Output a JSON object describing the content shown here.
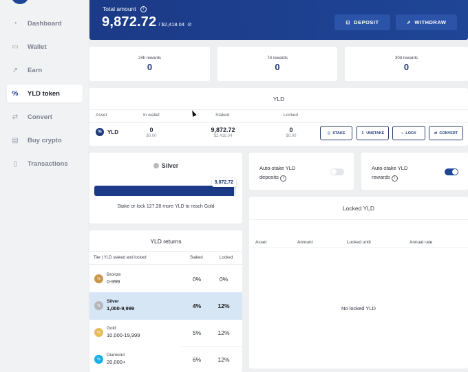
{
  "sidebar": {
    "items": [
      {
        "label": "Dashboard",
        "icon": "dashboard-icon",
        "glyph": "◔",
        "active": false
      },
      {
        "label": "Wallet",
        "icon": "wallet-icon",
        "glyph": "▭",
        "active": false
      },
      {
        "label": "Earn",
        "icon": "trending-up-icon",
        "glyph": "↗",
        "active": false
      },
      {
        "label": "YLD token",
        "icon": "percent-icon",
        "glyph": "%",
        "active": true
      },
      {
        "label": "Convert",
        "icon": "convert-icon",
        "glyph": "⇄",
        "active": false
      },
      {
        "label": "Buy crypto",
        "icon": "card-icon",
        "glyph": "▤",
        "active": false
      },
      {
        "label": "Transactions",
        "icon": "receipt-icon",
        "glyph": "▯",
        "active": false
      }
    ]
  },
  "header": {
    "total_label": "Total amount",
    "total_value": "9,872.72",
    "total_fiat": "/ $2,418.04",
    "deposit_label": "DEPOSIT",
    "withdraw_label": "WITHDRAW",
    "deposit_glyph": "⊡",
    "withdraw_glyph": "⇗"
  },
  "rewards": [
    {
      "label": "24h rewards",
      "value": "0"
    },
    {
      "label": "7d rewards",
      "value": "0"
    },
    {
      "label": "30d rewards",
      "value": "0"
    }
  ],
  "yld_table": {
    "title": "YLD",
    "columns": [
      "Asset",
      "In wallet",
      "Staked",
      "Locked"
    ],
    "row": {
      "asset": "YLD",
      "asset_glyph": "%",
      "in_wallet": "0",
      "in_wallet_fiat": "$0.00",
      "staked": "9,872.72",
      "staked_fiat": "$2,418.04",
      "locked": "0",
      "locked_fiat": "$0.00"
    },
    "actions": [
      {
        "label": "STAKE",
        "glyph": "◎"
      },
      {
        "label": "UNSTAKE",
        "glyph": "↥"
      },
      {
        "label": "LOCK",
        "glyph": "⌂"
      },
      {
        "label": "CONVERT",
        "glyph": "⇄"
      }
    ]
  },
  "tier": {
    "name": "Silver",
    "current": "9,872.72",
    "progress_fraction": 0.987,
    "message": "Stake or lock 127.28 more YLD to reach Gold"
  },
  "toggles": [
    {
      "line1": "Auto-stake YLD",
      "line2": "deposits",
      "on": false
    },
    {
      "line1": "Auto-stake YLD",
      "line2": "rewards",
      "on": true
    }
  ],
  "returns": {
    "title": "YLD returns",
    "columns": [
      "Tier | YLD staked and locked",
      "Staked",
      "Locked"
    ],
    "rows": [
      {
        "tier": "Bronze",
        "range": "0-999",
        "staked": "0%",
        "locked": "0%",
        "color": "#c9974a",
        "highlight": false
      },
      {
        "tier": "Silver",
        "range": "1,000-9,999",
        "staked": "4%",
        "locked": "12%",
        "color": "#b4b6ba",
        "highlight": true
      },
      {
        "tier": "Gold",
        "range": "10,000-19,999",
        "staked": "5%",
        "locked": "12%",
        "color": "#e6bd5a",
        "highlight": false
      },
      {
        "tier": "Diamond",
        "range": "20,000+",
        "staked": "6%",
        "locked": "12%",
        "color": "#1ab0e8",
        "highlight": false
      }
    ]
  },
  "locked": {
    "title": "Locked YLD",
    "columns": [
      "Asset",
      "Amount",
      "Locked until",
      "Annual rate"
    ],
    "empty": "No locked YLD"
  }
}
